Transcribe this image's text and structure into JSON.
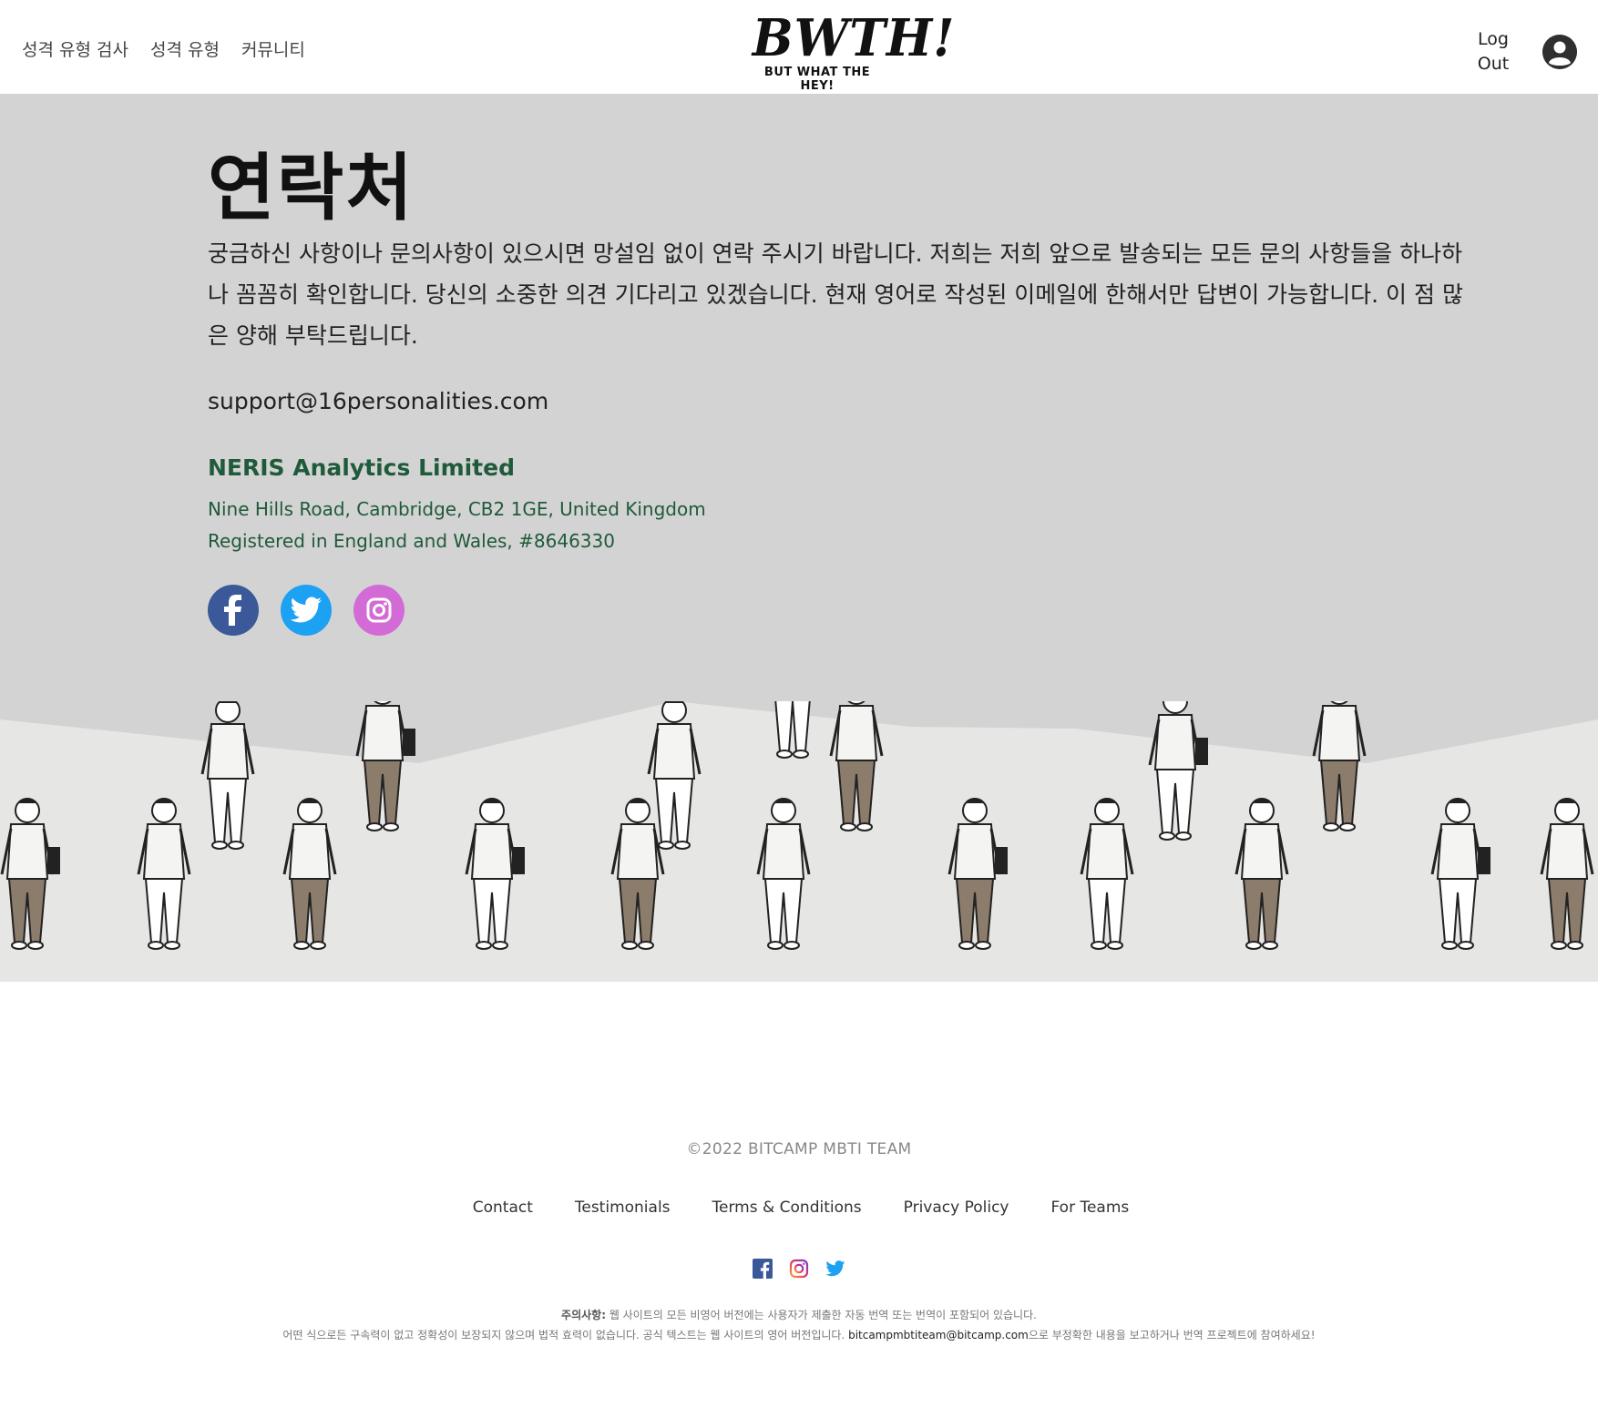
{
  "header": {
    "nav": [
      "성격 유형 검사",
      "성격 유형",
      "커뮤니티"
    ],
    "logo_main": "BWTH!",
    "logo_sub": "BUT WHAT THE HEY!",
    "logout_line1": "Log",
    "logout_line2": "Out"
  },
  "contact": {
    "title": "연락처",
    "description": "궁금하신 사항이나 문의사항이 있으시면 망설임 없이 연락 주시기 바랍니다. 저희는 저희 앞으로 발송되는 모든 문의 사항들을 하나하나 꼼꼼히 확인합니다. 당신의 소중한 의견 기다리고 있겠습니다. 현재 영어로 작성된 이메일에 한해서만 답변이 가능합니다. 이 점 많은 양해 부탁드립니다.",
    "email": "support@16personalities.com",
    "company": "NERIS Analytics Limited",
    "address": "Nine Hills Road, Cambridge, CB2 1GE, United Kingdom",
    "registration": "Registered in England and Wales, #8646330",
    "social_icons": [
      "facebook-icon",
      "twitter-icon",
      "instagram-icon"
    ],
    "colors": {
      "background": "#d3d3d3",
      "company": "#1f5a3a",
      "facebook": "#3b5998",
      "twitter": "#1da1f2",
      "instagram": "#d36bd6"
    }
  },
  "footer": {
    "copyright": "©2022 BITCAMP MBTI TEAM",
    "links": [
      "Contact",
      "Testimonials",
      "Terms & Conditions",
      "Privacy Policy",
      "For Teams"
    ],
    "social_icons": [
      "facebook-icon",
      "instagram-icon",
      "twitter-icon"
    ],
    "disclaimer_label": "주의사항:",
    "disclaimer_line1": " 웹 사이트의 모든 비영어 버전에는 사용자가 제출한 자동 번역 또는 번역이 포함되어 있습니다.",
    "disclaimer_line2_pre": "어떤 식으로든 구속력이 없고 정확성이 보장되지 않으며 법적 효력이 없습니다. 공식 텍스트는 웹 사이트의 영어 버전입니다. ",
    "disclaimer_email": "bitcampmbtiteam@bitcamp.com",
    "disclaimer_line2_post": "으로 부정확한 내용을 보고하거나 번역 프로젝트에 참여하세요!"
  }
}
